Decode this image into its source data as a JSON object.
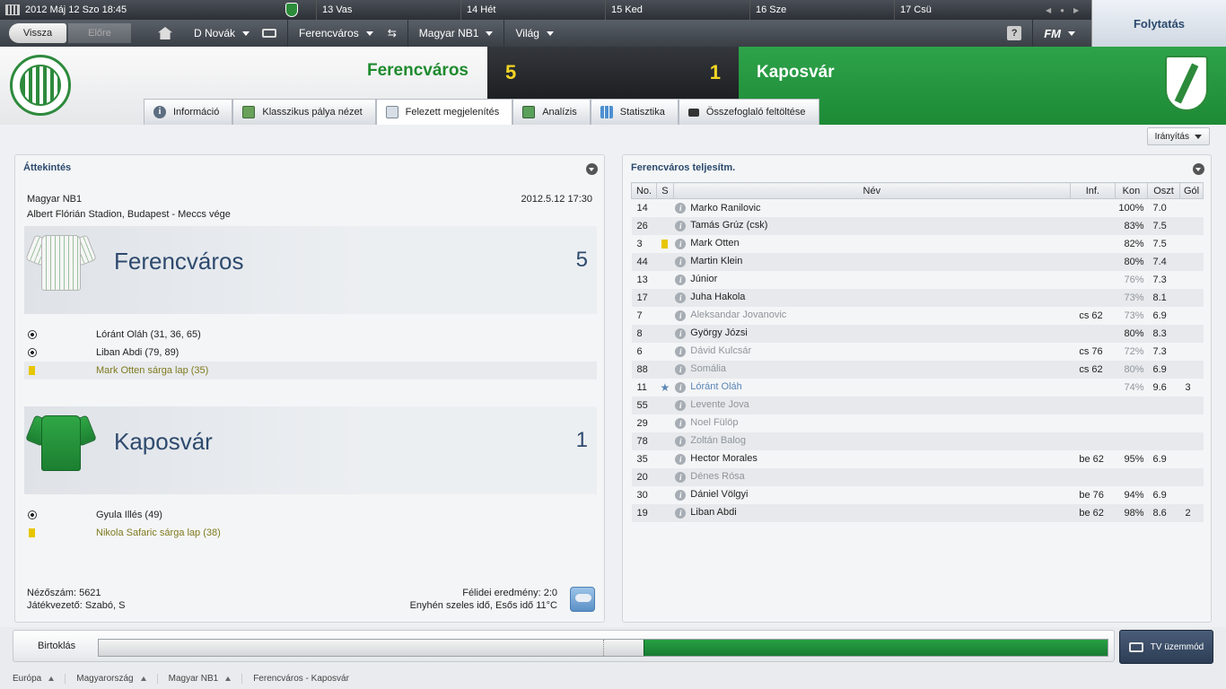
{
  "topbar": {
    "date": "2012 Máj 12  Szo  18:45",
    "days": [
      "13  Vas",
      "14  Hét",
      "15  Ked",
      "16  Sze",
      "17  Csü"
    ],
    "continue_label": "Folytatás"
  },
  "nav": {
    "back_label": "Vissza",
    "forward_label": "Előre",
    "manager": "D Novák",
    "club": "Ferencváros",
    "league": "Magyar NB1",
    "world": "Világ",
    "help": "?",
    "fm_logo": "FM"
  },
  "match": {
    "home_team": "Ferencváros",
    "away_team": "Kaposvár",
    "home_score": "5",
    "away_score": "1"
  },
  "tabs": [
    {
      "label": "Információ",
      "icon": "info-icon"
    },
    {
      "label": "Klasszikus pálya nézet",
      "icon": "pitch-icon"
    },
    {
      "label": "Felezett megjelenítés",
      "icon": "split-view-icon"
    },
    {
      "label": "Analízis",
      "icon": "analysis-icon"
    },
    {
      "label": "Statisztika",
      "icon": "stats-icon"
    },
    {
      "label": "Összefoglaló feltöltése",
      "icon": "camera-icon"
    }
  ],
  "steer_label": "Irányítás",
  "overview": {
    "title": "Áttekintés",
    "competition": "Magyar NB1",
    "venue": "Albert Flórián Stadion, Budapest - Meccs vége",
    "kickoff": "2012.5.12 17:30",
    "home": {
      "name": "Ferencváros",
      "score": "5",
      "events": [
        {
          "type": "goal",
          "text": "Lóránt Oláh (31, 36, 65)"
        },
        {
          "type": "goal",
          "text": "Liban Abdi (79, 89)"
        },
        {
          "type": "yellow",
          "text": "Mark Otten sárga lap (35)"
        }
      ]
    },
    "away": {
      "name": "Kaposvár",
      "score": "1",
      "events": [
        {
          "type": "goal",
          "text": "Gyula Illés (49)"
        },
        {
          "type": "yellow",
          "text": "Nikola Safaric sárga lap (38)"
        }
      ]
    },
    "attendance": "Nézőszám: 5621",
    "referee": "Játékvezető: Szabó, S",
    "halftime": "Félidei eredmény: 2:0",
    "weather": "Enyhén szeles idő, Esős idő 11°C"
  },
  "performance": {
    "title": "Ferencváros teljesítm.",
    "headers": {
      "no": "No.",
      "s": "S",
      "name": "Név",
      "inf": "Inf.",
      "kon": "Kon",
      "oszt": "Oszt",
      "gol": "Gól"
    },
    "rows": [
      {
        "no": "14",
        "s": "",
        "name": "Marko Ranilovic",
        "inf": "",
        "kon": "100%",
        "oszt": "7.0",
        "gol": "",
        "style": ""
      },
      {
        "no": "26",
        "s": "",
        "name": "Tamás Grúz (csk)",
        "inf": "",
        "kon": "83%",
        "oszt": "7.5",
        "gol": "",
        "style": ""
      },
      {
        "no": "3",
        "s": "yellow",
        "name": "Mark Otten",
        "inf": "",
        "kon": "82%",
        "oszt": "7.5",
        "gol": "",
        "style": ""
      },
      {
        "no": "44",
        "s": "",
        "name": "Martin Klein",
        "inf": "",
        "kon": "80%",
        "oszt": "7.4",
        "gol": "",
        "style": ""
      },
      {
        "no": "13",
        "s": "",
        "name": "Júnior",
        "inf": "",
        "kon": "76%",
        "oszt": "7.3",
        "gol": "",
        "style": ""
      },
      {
        "no": "17",
        "s": "",
        "name": "Juha Hakola",
        "inf": "",
        "kon": "73%",
        "oszt": "8.1",
        "gol": "",
        "style": ""
      },
      {
        "no": "7",
        "s": "",
        "name": "Aleksandar Jovanovic",
        "inf": "cs 62",
        "kon": "73%",
        "oszt": "6.9",
        "gol": "",
        "style": "muted"
      },
      {
        "no": "8",
        "s": "",
        "name": "György Józsi",
        "inf": "",
        "kon": "80%",
        "oszt": "8.3",
        "gol": "",
        "style": ""
      },
      {
        "no": "6",
        "s": "",
        "name": "Dávid Kulcsár",
        "inf": "cs 76",
        "kon": "72%",
        "oszt": "7.3",
        "gol": "",
        "style": "muted"
      },
      {
        "no": "88",
        "s": "",
        "name": "Somália",
        "inf": "cs 62",
        "kon": "80%",
        "oszt": "6.9",
        "gol": "",
        "style": "muted"
      },
      {
        "no": "11",
        "s": "star",
        "name": "Lóránt Oláh",
        "inf": "",
        "kon": "74%",
        "oszt": "9.6",
        "gol": "3",
        "style": "hl"
      },
      {
        "no": "55",
        "s": "",
        "name": "Levente Jova",
        "inf": "",
        "kon": "",
        "oszt": "",
        "gol": "",
        "style": "muted"
      },
      {
        "no": "29",
        "s": "",
        "name": "Noel Fülöp",
        "inf": "",
        "kon": "",
        "oszt": "",
        "gol": "",
        "style": "muted"
      },
      {
        "no": "78",
        "s": "",
        "name": "Zoltán Balog",
        "inf": "",
        "kon": "",
        "oszt": "",
        "gol": "",
        "style": "muted"
      },
      {
        "no": "35",
        "s": "",
        "name": "Hector Morales",
        "inf": "be 62",
        "kon": "95%",
        "oszt": "6.9",
        "gol": "",
        "style": ""
      },
      {
        "no": "20",
        "s": "",
        "name": "Dénes Rósa",
        "inf": "",
        "kon": "",
        "oszt": "",
        "gol": "",
        "style": "muted"
      },
      {
        "no": "30",
        "s": "",
        "name": "Dániel Völgyi",
        "inf": "be 76",
        "kon": "94%",
        "oszt": "6.9",
        "gol": "",
        "style": ""
      },
      {
        "no": "19",
        "s": "",
        "name": "Liban Abdi",
        "inf": "be 62",
        "kon": "98%",
        "oszt": "8.6",
        "gol": "2",
        "style": ""
      }
    ]
  },
  "possession": {
    "label": "Birtoklás",
    "away_share": 0.46
  },
  "tv_label": "TV üzemmód",
  "breadcrumb": [
    "Európa",
    "Magyarország",
    "Magyar NB1",
    "Ferencváros - Kaposvár"
  ]
}
